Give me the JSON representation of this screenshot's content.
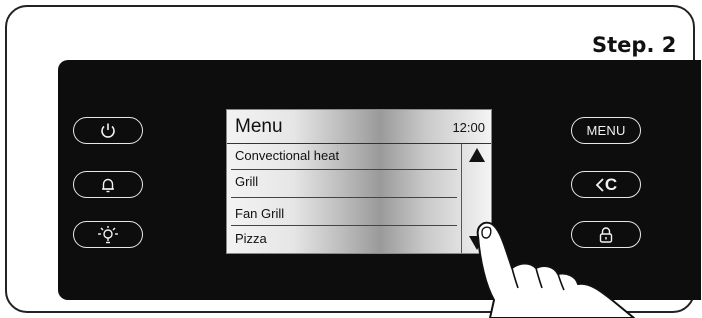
{
  "step_label": "Step. 2",
  "screen": {
    "title": "Menu",
    "time": "12:00",
    "items": [
      "Convectional heat",
      "Grill",
      "Fan Grill",
      "Pizza"
    ]
  },
  "buttons": {
    "menu_label": "MENU",
    "back_label": "C"
  },
  "icons": {
    "power": "power-icon",
    "alarm": "bell-icon",
    "light": "lamp-icon",
    "back": "back-arrow-icon",
    "lock": "lock-icon",
    "scroll_up": "arrow-up-icon",
    "scroll_down": "arrow-down-icon"
  }
}
